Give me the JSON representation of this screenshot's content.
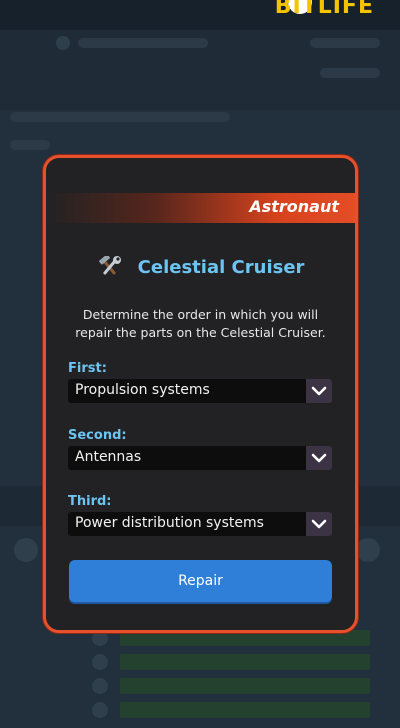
{
  "modal": {
    "banner_label": "Astronaut",
    "title": "Celestial Cruiser",
    "title_icon": "tools-icon",
    "description": "Determine the order in which you will repair the parts on the Celestial Cruiser.",
    "fields": [
      {
        "label": "First:",
        "value": "Propulsion systems"
      },
      {
        "label": "Second:",
        "value": "Antennas"
      },
      {
        "label": "Third:",
        "value": "Power distribution systems"
      }
    ],
    "repair_label": "Repair"
  },
  "colors": {
    "accent_orange": "#e5502d",
    "title_blue": "#6cc4f2",
    "button_blue": "#2f7fd9"
  },
  "background": {
    "app_logo": "BITLIFE"
  }
}
